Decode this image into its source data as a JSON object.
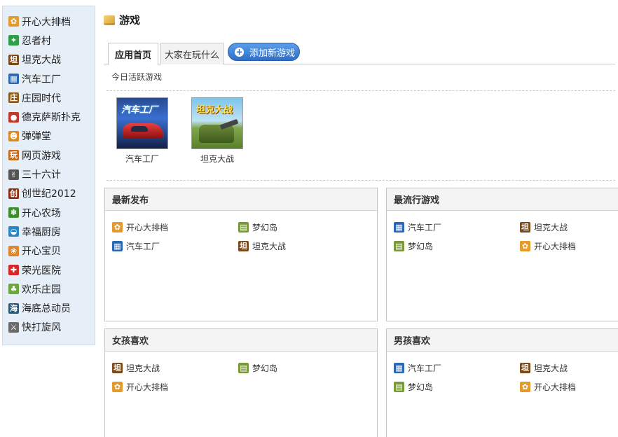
{
  "sidebar": {
    "items": [
      {
        "label": "开心大排档",
        "icon": "dining-icon",
        "color": "#e59a2c",
        "glyph": "✿"
      },
      {
        "label": "忍者村",
        "icon": "ninja-icon",
        "color": "#2f9e4a",
        "glyph": "✦"
      },
      {
        "label": "坦克大战",
        "icon": "tank-icon",
        "color": "#7a4a1a",
        "glyph": "坦"
      },
      {
        "label": "汽车工厂",
        "icon": "car-factory-icon",
        "color": "#2b67b3",
        "glyph": "▦"
      },
      {
        "label": "庄园时代",
        "icon": "manor-icon",
        "color": "#8a5a1c",
        "glyph": "庄"
      },
      {
        "label": "德克萨斯扑克",
        "icon": "poker-icon",
        "color": "#c0392b",
        "glyph": "●"
      },
      {
        "label": "弹弹堂",
        "icon": "ddtank-icon",
        "color": "#d98a22",
        "glyph": "☻"
      },
      {
        "label": "网页游戏",
        "icon": "webgame-icon",
        "color": "#c96a12",
        "glyph": "玩"
      },
      {
        "label": "三十六计",
        "icon": "strategy-icon",
        "color": "#555555",
        "glyph": "✌"
      },
      {
        "label": "创世纪2012",
        "icon": "genesis-icon",
        "color": "#8b2e12",
        "glyph": "创"
      },
      {
        "label": "开心农场",
        "icon": "farm-icon",
        "color": "#3e8e2e",
        "glyph": "✽"
      },
      {
        "label": "幸福厨房",
        "icon": "kitchen-icon",
        "color": "#2a86c4",
        "glyph": "◒"
      },
      {
        "label": "开心宝贝",
        "icon": "baby-icon",
        "color": "#e0842a",
        "glyph": "❀"
      },
      {
        "label": "荣光医院",
        "icon": "hospital-icon",
        "color": "#d62828",
        "glyph": "✚"
      },
      {
        "label": "欢乐庄园",
        "icon": "happy-manor-icon",
        "color": "#6aa83a",
        "glyph": "♣"
      },
      {
        "label": "海底总动员",
        "icon": "ocean-icon",
        "color": "#2a5a7a",
        "glyph": "海"
      },
      {
        "label": "快打旋风",
        "icon": "fight-icon",
        "color": "#6a6a6a",
        "glyph": "⚔"
      }
    ]
  },
  "header": {
    "title": "游戏",
    "icon": "box-icon"
  },
  "tabs": {
    "home": "应用首页",
    "playing": "大家在玩什么",
    "add_game": "添加新游戏",
    "add_glyph": "+"
  },
  "active": {
    "label": "今日活跃游戏",
    "games": [
      {
        "caption": "汽车工厂",
        "thumb_title": "汽车工厂"
      },
      {
        "caption": "坦克大战",
        "thumb_title": "坦克大战"
      }
    ]
  },
  "panels": {
    "latest": {
      "title": "最新发布",
      "games": [
        "开心大排档",
        "梦幻岛",
        "汽车工厂",
        "坦克大战"
      ]
    },
    "popular": {
      "title": "最流行游戏",
      "games": [
        "汽车工厂",
        "坦克大战",
        "梦幻岛",
        "开心大排档"
      ]
    },
    "girls": {
      "title": "女孩喜欢",
      "games": [
        "坦克大战",
        "梦幻岛",
        "开心大排档"
      ]
    },
    "boys": {
      "title": "男孩喜欢",
      "games": [
        "汽车工厂",
        "坦克大战",
        "梦幻岛",
        "开心大排档"
      ]
    }
  },
  "game_icons": {
    "开心大排档": {
      "icon": "dining-icon",
      "color": "#e59a2c",
      "glyph": "✿"
    },
    "梦幻岛": {
      "icon": "dream-island-icon",
      "color": "#7a9a3a",
      "glyph": "▤"
    },
    "汽车工厂": {
      "icon": "car-factory-icon",
      "color": "#2b67b3",
      "glyph": "▦"
    },
    "坦克大战": {
      "icon": "tank-icon",
      "color": "#7a4a1a",
      "glyph": "坦"
    }
  }
}
